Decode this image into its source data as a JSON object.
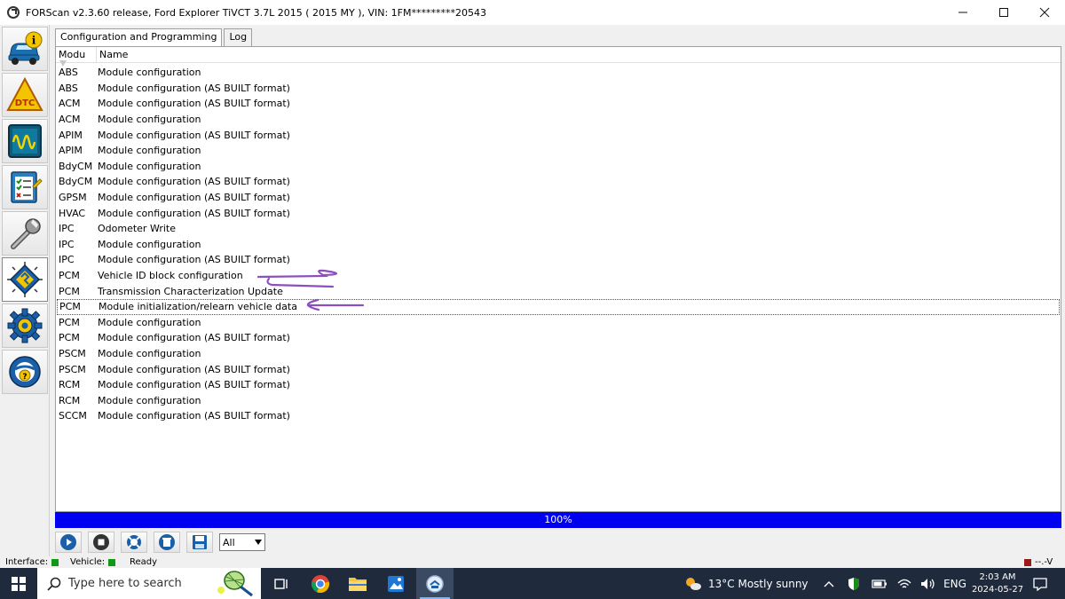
{
  "window": {
    "title": "FORScan v2.3.60 release, Ford Explorer TiVCT 3.7L 2015 ( 2015 MY ), VIN: 1FM*********20543"
  },
  "sidebar": {
    "items": [
      {
        "icon": "car-info-icon"
      },
      {
        "icon": "dtc-icon",
        "label": "DTC"
      },
      {
        "icon": "oscilloscope-icon"
      },
      {
        "icon": "checklist-icon"
      },
      {
        "icon": "wrench-icon"
      },
      {
        "icon": "chip-icon"
      },
      {
        "icon": "gear-icon"
      },
      {
        "icon": "help-icon",
        "label": "?"
      }
    ]
  },
  "tabs": [
    {
      "label": "Configuration and Programming"
    },
    {
      "label": "Log"
    }
  ],
  "list": {
    "headers": {
      "module": "Modu",
      "name": "Name"
    },
    "rows": [
      {
        "module": "ABS",
        "name": "Module configuration"
      },
      {
        "module": "ABS",
        "name": "Module configuration (AS BUILT format)"
      },
      {
        "module": "ACM",
        "name": "Module configuration (AS BUILT format)"
      },
      {
        "module": "ACM",
        "name": "Module configuration"
      },
      {
        "module": "APIM",
        "name": "Module configuration (AS BUILT format)"
      },
      {
        "module": "APIM",
        "name": "Module configuration"
      },
      {
        "module": "BdyCM",
        "name": "Module configuration"
      },
      {
        "module": "BdyCM",
        "name": "Module configuration (AS BUILT format)"
      },
      {
        "module": "GPSM",
        "name": "Module configuration (AS BUILT format)"
      },
      {
        "module": "HVAC",
        "name": "Module configuration (AS BUILT format)"
      },
      {
        "module": "IPC",
        "name": "Odometer Write"
      },
      {
        "module": "IPC",
        "name": "Module configuration"
      },
      {
        "module": "IPC",
        "name": "Module configuration (AS BUILT format)"
      },
      {
        "module": "PCM",
        "name": "Vehicle ID block configuration"
      },
      {
        "module": "PCM",
        "name": "Transmission Characterization Update"
      },
      {
        "module": "PCM",
        "name": "Module initialization/relearn vehicle data"
      },
      {
        "module": "PCM",
        "name": "Module configuration"
      },
      {
        "module": "PCM",
        "name": "Module configuration (AS BUILT format)"
      },
      {
        "module": "PSCM",
        "name": "Module configuration"
      },
      {
        "module": "PSCM",
        "name": "Module configuration (AS BUILT format)"
      },
      {
        "module": "RCM",
        "name": "Module configuration (AS BUILT format)"
      },
      {
        "module": "RCM",
        "name": "Module configuration"
      },
      {
        "module": "SCCM",
        "name": "Module configuration (AS BUILT format)"
      }
    ],
    "selected_index": 15,
    "annotation_color": "#8b4fc0"
  },
  "progress": {
    "label": "100%",
    "value": 1.0,
    "color": "#0000f0"
  },
  "toolbar": {
    "buttons": [
      "play-icon",
      "stop-icon",
      "lifebuoy-icon",
      "erase-icon",
      "save-icon"
    ],
    "filter_value": "All"
  },
  "status": {
    "interface_label": "Interface:",
    "vehicle_label": "Vehicle:",
    "ready_text": "Ready",
    "voltage_text": "--.-V"
  },
  "taskbar": {
    "search_placeholder": "Type here to search",
    "weather": "13°C  Mostly sunny",
    "language": "ENG",
    "time": "2:03 AM",
    "date": "2024-05-27"
  }
}
